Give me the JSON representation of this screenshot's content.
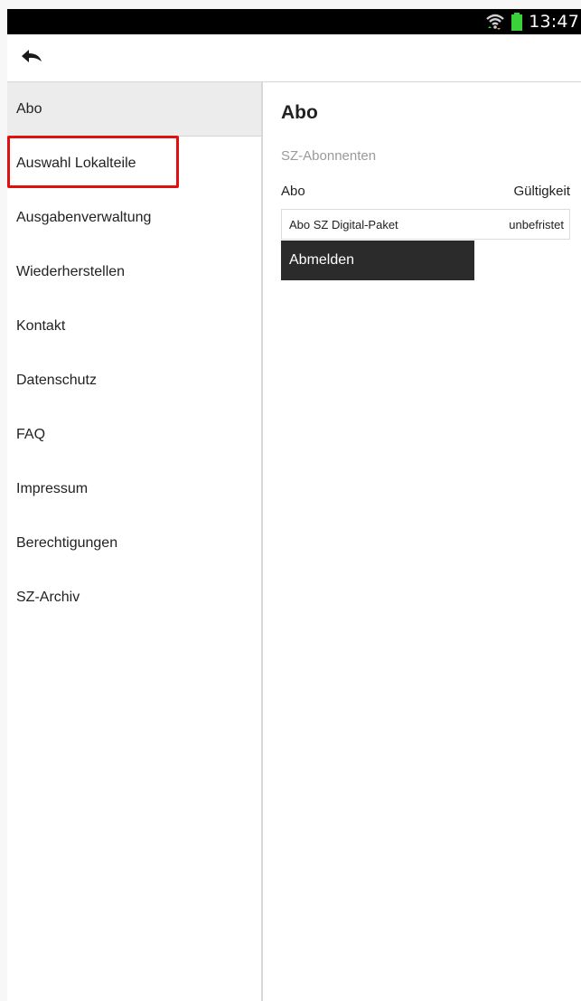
{
  "status_bar": {
    "time": "13:47"
  },
  "icons": {
    "wifi": "wifi-icon",
    "battery": "battery-icon",
    "back": "back-arrow-icon"
  },
  "colors": {
    "battery": "#3bd13b",
    "highlight": "#e01010",
    "button_bg": "#2b2b2b"
  },
  "sidebar": {
    "items": [
      {
        "label": "Abo"
      },
      {
        "label": "Auswahl Lokalteile"
      },
      {
        "label": "Ausgabenverwaltung"
      },
      {
        "label": "Wiederherstellen"
      },
      {
        "label": "Kontakt"
      },
      {
        "label": "Datenschutz"
      },
      {
        "label": "FAQ"
      },
      {
        "label": "Impressum"
      },
      {
        "label": "Berechtigungen"
      },
      {
        "label": "SZ-Archiv"
      }
    ]
  },
  "main": {
    "title": "Abo",
    "subtitle": "SZ-Abonnenten",
    "table": {
      "headers": [
        "Abo",
        "Gültigkeit"
      ],
      "rows": [
        [
          "Abo SZ Digital-Paket",
          "unbefristet"
        ]
      ]
    },
    "signout_label": "Abmelden"
  }
}
